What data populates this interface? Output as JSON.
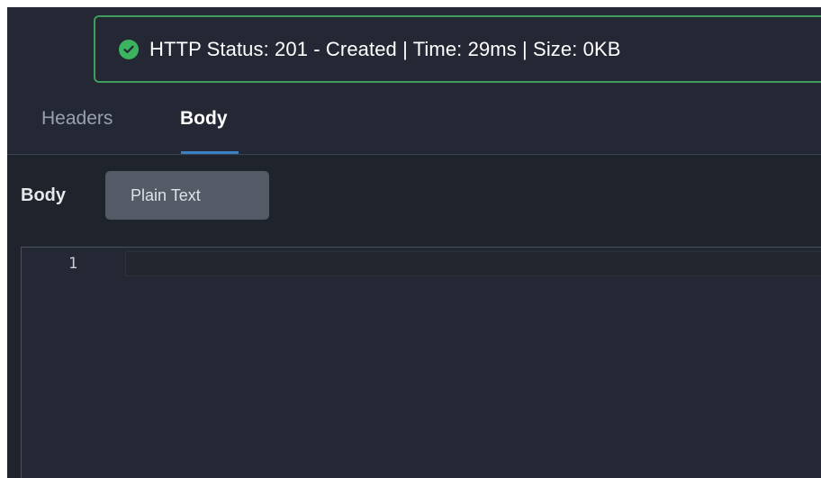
{
  "status": {
    "text": "HTTP Status: 201 - Created | Time: 29ms | Size: 0KB",
    "icon": "check-circle-icon",
    "color": "#3bb35f"
  },
  "tabs": [
    {
      "label": "Headers",
      "active": false
    },
    {
      "label": "Body",
      "active": true
    }
  ],
  "body": {
    "label": "Body",
    "format": "Plain Text"
  },
  "editor": {
    "line_numbers": [
      "1"
    ],
    "content": ""
  },
  "colors": {
    "background": "#232834",
    "accent": "#3b82c4",
    "success_border": "#3f9c5a"
  }
}
